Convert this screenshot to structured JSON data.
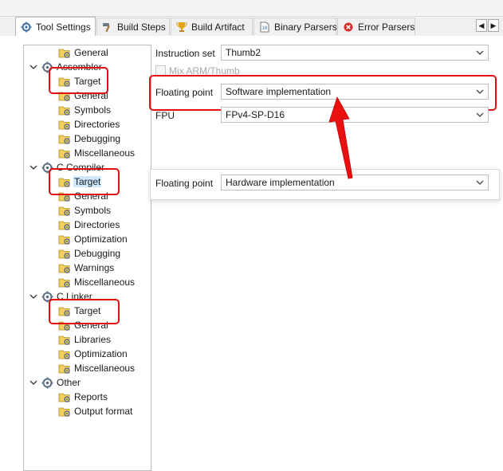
{
  "tabs": [
    {
      "label": "Tool Settings",
      "icon": "gear-icon",
      "active": true
    },
    {
      "label": "Build Steps",
      "icon": "hammer-icon",
      "active": false
    },
    {
      "label": "Build Artifact",
      "icon": "trophy-icon",
      "active": false
    },
    {
      "label": "Binary Parsers",
      "icon": "binary-icon",
      "active": false
    },
    {
      "label": "Error Parsers",
      "icon": "error-icon",
      "active": false
    }
  ],
  "tab_nav": {
    "prev": "◀",
    "next": "▶"
  },
  "tree": [
    {
      "label": "General",
      "level": 1,
      "icon": "folder-gear-icon"
    },
    {
      "label": "Assembler",
      "level": 0,
      "icon": "tool-gear-icon",
      "expanded": true
    },
    {
      "label": "Target",
      "level": 1,
      "icon": "folder-gear-icon"
    },
    {
      "label": "General",
      "level": 1,
      "icon": "folder-gear-icon"
    },
    {
      "label": "Symbols",
      "level": 1,
      "icon": "folder-gear-icon"
    },
    {
      "label": "Directories",
      "level": 1,
      "icon": "folder-gear-icon"
    },
    {
      "label": "Debugging",
      "level": 1,
      "icon": "folder-gear-icon"
    },
    {
      "label": "Miscellaneous",
      "level": 1,
      "icon": "folder-gear-icon"
    },
    {
      "label": "C Compiler",
      "level": 0,
      "icon": "tool-gear-icon",
      "expanded": true
    },
    {
      "label": "Target",
      "level": 1,
      "icon": "folder-gear-icon",
      "selected": true
    },
    {
      "label": "General",
      "level": 1,
      "icon": "folder-gear-icon"
    },
    {
      "label": "Symbols",
      "level": 1,
      "icon": "folder-gear-icon"
    },
    {
      "label": "Directories",
      "level": 1,
      "icon": "folder-gear-icon"
    },
    {
      "label": "Optimization",
      "level": 1,
      "icon": "folder-gear-icon"
    },
    {
      "label": "Debugging",
      "level": 1,
      "icon": "folder-gear-icon"
    },
    {
      "label": "Warnings",
      "level": 1,
      "icon": "folder-gear-icon"
    },
    {
      "label": "Miscellaneous",
      "level": 1,
      "icon": "folder-gear-icon"
    },
    {
      "label": "C Linker",
      "level": 0,
      "icon": "tool-gear-icon",
      "expanded": true
    },
    {
      "label": "Target",
      "level": 1,
      "icon": "folder-gear-icon"
    },
    {
      "label": "General",
      "level": 1,
      "icon": "folder-gear-icon"
    },
    {
      "label": "Libraries",
      "level": 1,
      "icon": "folder-gear-icon"
    },
    {
      "label": "Optimization",
      "level": 1,
      "icon": "folder-gear-icon"
    },
    {
      "label": "Miscellaneous",
      "level": 1,
      "icon": "folder-gear-icon"
    },
    {
      "label": "Other",
      "level": 0,
      "icon": "tool-gear-icon",
      "expanded": true
    },
    {
      "label": "Reports",
      "level": 1,
      "icon": "folder-gear-icon"
    },
    {
      "label": "Output format",
      "level": 1,
      "icon": "folder-gear-icon"
    }
  ],
  "settings": {
    "instruction_set": {
      "label": "Instruction set",
      "value": "Thumb2"
    },
    "mix_arm_thumb": {
      "label": "Mix ARM/Thumb",
      "checked": false,
      "disabled": true
    },
    "floating_point": {
      "label": "Floating point",
      "value": "Software implementation"
    },
    "fpu": {
      "label": "FPU",
      "value": "FPv4-SP-D16"
    }
  },
  "popup": {
    "label": "Floating point",
    "value": "Hardware implementation"
  },
  "colors": {
    "annotation_red": "#e01010",
    "selection_blue": "#cde8ff"
  }
}
